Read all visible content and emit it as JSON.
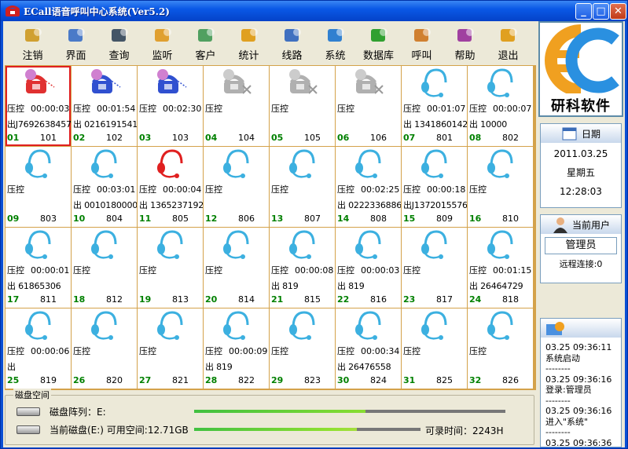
{
  "window": {
    "title": "ECall语音呼叫中心系统(Ver5.2)",
    "min": "_",
    "max": "□",
    "close": "✕"
  },
  "toolbar": [
    {
      "label": "注销",
      "icon": "logout-users-icon",
      "color": "#d0a030"
    },
    {
      "label": "界面",
      "icon": "interface-window-icon",
      "color": "#4a7ac8"
    },
    {
      "label": "查询",
      "icon": "query-chess-icon",
      "color": "#445566"
    },
    {
      "label": "监听",
      "icon": "monitor-headset-icon",
      "color": "#e0a030"
    },
    {
      "label": "客户",
      "icon": "customer-icon",
      "color": "#50a060"
    },
    {
      "label": "统计",
      "icon": "statistics-icon",
      "color": "#e0a020"
    },
    {
      "label": "线路",
      "icon": "line-icon",
      "color": "#4070c0"
    },
    {
      "label": "系统",
      "icon": "system-icon",
      "color": "#3080d0"
    },
    {
      "label": "数据库",
      "icon": "database-icon",
      "color": "#30a030"
    },
    {
      "label": "呼叫",
      "icon": "call-icon",
      "color": "#d08030"
    },
    {
      "label": "帮助",
      "icon": "help-book-icon",
      "color": "#a040a0"
    },
    {
      "label": "退出",
      "icon": "exit-icon",
      "color": "#e0a020"
    }
  ],
  "channels": [
    {
      "num": "01",
      "ext": "101",
      "status": "压控",
      "time": "00:00:03",
      "phone": "出J76926384577",
      "icon": "phone-red",
      "selected": true
    },
    {
      "num": "02",
      "ext": "102",
      "status": "压控",
      "time": "00:01:54",
      "phone": "出 02161915417",
      "icon": "phone-blue"
    },
    {
      "num": "03",
      "ext": "103",
      "status": "压控",
      "time": "00:02:30",
      "phone": "",
      "icon": "phone-blue"
    },
    {
      "num": "04",
      "ext": "104",
      "status": "压控",
      "time": "",
      "phone": "",
      "icon": "phone-gray"
    },
    {
      "num": "05",
      "ext": "105",
      "status": "压控",
      "time": "",
      "phone": "",
      "icon": "phone-gray"
    },
    {
      "num": "06",
      "ext": "106",
      "status": "压控",
      "time": "",
      "phone": "",
      "icon": "phone-gray"
    },
    {
      "num": "07",
      "ext": "801",
      "status": "压控",
      "time": "00:01:07",
      "phone": "出 13418601422",
      "icon": "headset-cyan"
    },
    {
      "num": "08",
      "ext": "802",
      "status": "压控",
      "time": "00:00:07",
      "phone": "出      10000",
      "icon": "headset-cyan"
    },
    {
      "num": "09",
      "ext": "803",
      "status": "压控",
      "time": "",
      "phone": "",
      "icon": "headset-cyan"
    },
    {
      "num": "10",
      "ext": "804",
      "status": "压控",
      "time": "00:03:01",
      "phone": "出 00101800000",
      "icon": "headset-cyan"
    },
    {
      "num": "11",
      "ext": "805",
      "status": "压控",
      "time": "00:00:04",
      "phone": "出 13652371927",
      "icon": "headset-red"
    },
    {
      "num": "12",
      "ext": "806",
      "status": "压控",
      "time": "",
      "phone": "",
      "icon": "headset-cyan"
    },
    {
      "num": "13",
      "ext": "807",
      "status": "压控",
      "time": "",
      "phone": "",
      "icon": "headset-cyan"
    },
    {
      "num": "14",
      "ext": "808",
      "status": "压控",
      "time": "00:02:25",
      "phone": "出 02223368865",
      "icon": "headset-cyan"
    },
    {
      "num": "15",
      "ext": "809",
      "status": "压控",
      "time": "00:00:18",
      "phone": "出J13720155767",
      "icon": "headset-cyan"
    },
    {
      "num": "16",
      "ext": "810",
      "status": "压控",
      "time": "",
      "phone": "",
      "icon": "headset-cyan"
    },
    {
      "num": "17",
      "ext": "811",
      "status": "压控",
      "time": "00:00:01",
      "phone": "出   61865306",
      "icon": "headset-cyan"
    },
    {
      "num": "18",
      "ext": "812",
      "status": "压控",
      "time": "",
      "phone": "",
      "icon": "headset-cyan"
    },
    {
      "num": "19",
      "ext": "813",
      "status": "压控",
      "time": "",
      "phone": "",
      "icon": "headset-cyan"
    },
    {
      "num": "20",
      "ext": "814",
      "status": "压控",
      "time": "",
      "phone": "",
      "icon": "headset-cyan"
    },
    {
      "num": "21",
      "ext": "815",
      "status": "压控",
      "time": "00:00:08",
      "phone": "出        819",
      "icon": "headset-cyan"
    },
    {
      "num": "22",
      "ext": "816",
      "status": "压控",
      "time": "00:00:03",
      "phone": "出        819",
      "icon": "headset-cyan"
    },
    {
      "num": "23",
      "ext": "817",
      "status": "压控",
      "time": "",
      "phone": "",
      "icon": "headset-cyan"
    },
    {
      "num": "24",
      "ext": "818",
      "status": "压控",
      "time": "00:01:15",
      "phone": "出   26464729",
      "icon": "headset-cyan"
    },
    {
      "num": "25",
      "ext": "819",
      "status": "压控",
      "time": "00:00:06",
      "phone": "出",
      "icon": "headset-cyan"
    },
    {
      "num": "26",
      "ext": "820",
      "status": "压控",
      "time": "",
      "phone": "",
      "icon": "headset-cyan"
    },
    {
      "num": "27",
      "ext": "821",
      "status": "压控",
      "time": "",
      "phone": "",
      "icon": "headset-cyan"
    },
    {
      "num": "28",
      "ext": "822",
      "status": "压控",
      "time": "00:00:09",
      "phone": "出        819",
      "icon": "headset-cyan"
    },
    {
      "num": "29",
      "ext": "823",
      "status": "压控",
      "time": "",
      "phone": "",
      "icon": "headset-cyan"
    },
    {
      "num": "30",
      "ext": "824",
      "status": "压控",
      "time": "00:00:34",
      "phone": "出   26476558",
      "icon": "headset-cyan"
    },
    {
      "num": "31",
      "ext": "825",
      "status": "压控",
      "time": "",
      "phone": "",
      "icon": "headset-cyan"
    },
    {
      "num": "32",
      "ext": "826",
      "status": "压控",
      "time": "",
      "phone": "",
      "icon": "headset-cyan"
    }
  ],
  "disk": {
    "title": "磁盘空间",
    "array_label": "磁盘阵列：E:",
    "current_label": "当前磁盘(E:) 可用空间:12.71GB",
    "record_label": "可录时间：2243H",
    "array_fill": 0.55,
    "current_fill": 0.72
  },
  "side": {
    "logo_text": "研科软件",
    "date_header": "日期",
    "date": "2011.03.25",
    "weekday": "星期五",
    "time": "12:28:03",
    "user_header": "当前用户",
    "user": "管理员",
    "remote": "远程连接:0",
    "log": [
      "03.25 09:36:11",
      "系统启动",
      "--------",
      "03.25 09:36:16",
      "登录:管理员",
      "--------",
      "03.25 09:36:16",
      "进入\"系统\"",
      "--------",
      "03.25 09:36:36"
    ]
  }
}
